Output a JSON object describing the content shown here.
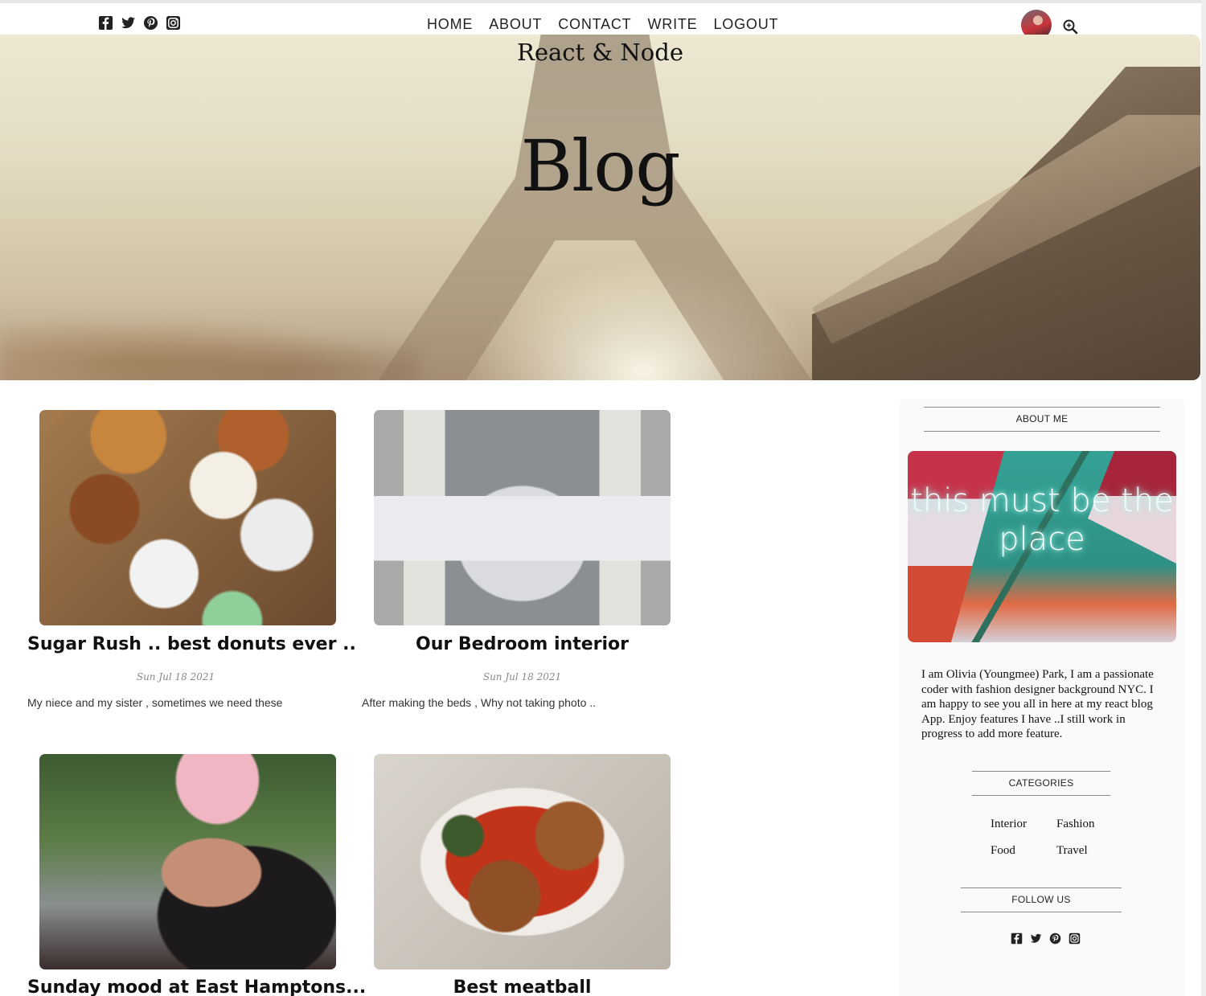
{
  "nav": {
    "social": [
      "facebook-square-icon",
      "twitter-icon",
      "pinterest-icon",
      "instagram-icon"
    ],
    "items": [
      "HOME",
      "ABOUT",
      "CONTACT",
      "WRITE",
      "LOGOUT"
    ],
    "search_icon": "search-plus-icon"
  },
  "header": {
    "subtitle": "React & Node",
    "title": "Blog"
  },
  "posts": [
    {
      "title": "Sugar Rush .. best donuts ever ..",
      "date": "Sun Jul 18 2021",
      "desc": "My niece and my sister , sometimes we need these"
    },
    {
      "title": "Our Bedroom interior",
      "date": "Sun Jul 18 2021",
      "desc": "After making the beds , Why not taking photo .."
    },
    {
      "title": "Sunday mood at East Hamptons...",
      "date": "",
      "desc": ""
    },
    {
      "title": "Best meatball",
      "date": "",
      "desc": ""
    }
  ],
  "sidebar": {
    "about_title": "ABOUT ME",
    "neon_text": "this must be the place",
    "about_text": "I am Olivia (Youngmee) Park, I am a passionate coder with fashion designer background NYC. I am happy to see you all in here at my react blog App. Enjoy features I have ..I still work in progress to add more feature.",
    "categories_title": "CATEGORIES",
    "categories": [
      "Interior",
      "Fashion",
      "Food",
      "Travel"
    ],
    "follow_title": "FOLLOW US"
  },
  "colors": {
    "text": "#222222",
    "date": "#888888",
    "sidebar_bg": "#fafafa"
  }
}
